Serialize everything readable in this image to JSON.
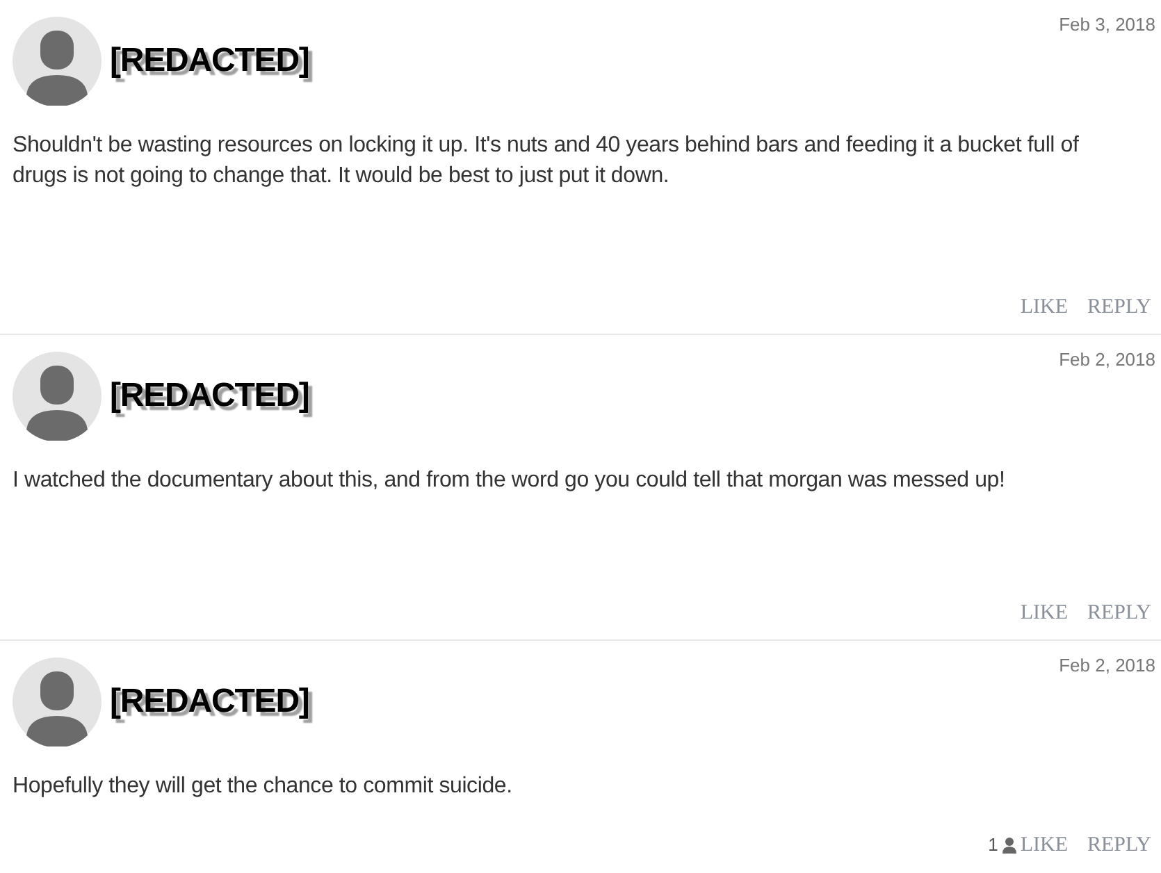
{
  "comments": [
    {
      "author": "[REDACTED]",
      "date": "Feb 3, 2018",
      "text": "Shouldn't be wasting resources on locking it up. It's nuts and 40 years behind bars and feeding it a bucket full of drugs is not going to change that. It would be best to just put it down.",
      "actions": [
        "LIKE",
        "REPLY"
      ]
    },
    {
      "author": "[REDACTED]",
      "date": "Feb 2, 2018",
      "text": "I watched the documentary about this, and from the word go you could tell that morgan was messed up!",
      "actions": [
        "LIKE",
        "REPLY"
      ]
    },
    {
      "author": "[REDACTED]",
      "date": "Feb 2, 2018",
      "text": "Hopefully they will get the chance to commit suicide.",
      "likes": "1",
      "actions": [
        "LIKE",
        "REPLY"
      ]
    }
  ]
}
